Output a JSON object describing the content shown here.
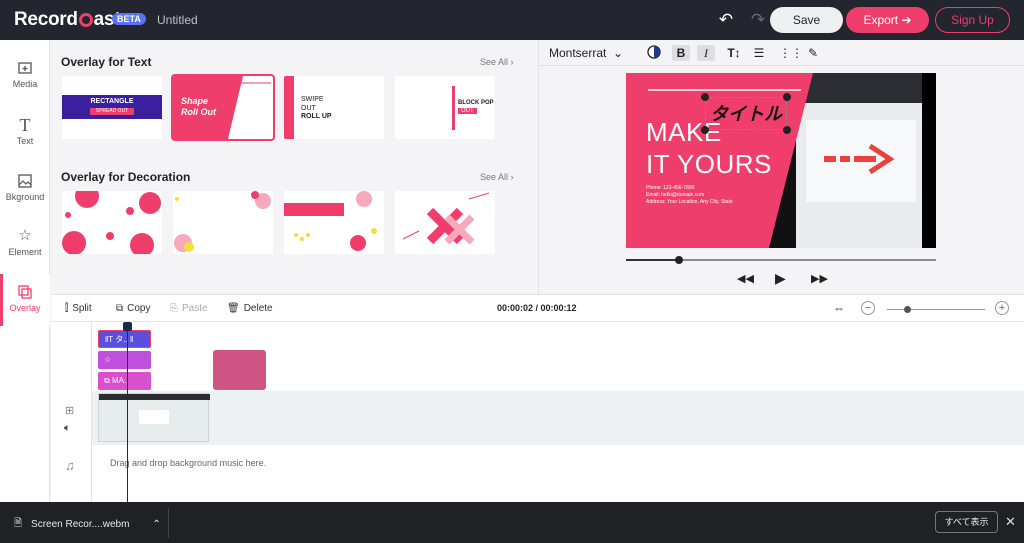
{
  "app": {
    "logo_left": "Record",
    "logo_right": "ast",
    "beta": "BETA",
    "doc_title": "Untitled"
  },
  "header": {
    "save": "Save",
    "export": "Export",
    "signup": "Sign Up",
    "undo_icon": "undo-icon",
    "redo_icon": "redo-icon"
  },
  "nav": [
    {
      "label": "Media",
      "icon": "media-icon"
    },
    {
      "label": "Text",
      "icon": "text-icon"
    },
    {
      "label": "Bkground",
      "icon": "background-icon"
    },
    {
      "label": "Element",
      "icon": "star-icon"
    },
    {
      "label": "Overlay",
      "icon": "overlay-icon",
      "active": true
    }
  ],
  "gallery": {
    "text_section": "Overlay for Text",
    "deco_section": "Overlay for Decoration",
    "see_all": "See All",
    "text_tiles": {
      "t1a": "RECTANGLE",
      "t1b": "SPREAD OUT",
      "t2a": "Shape",
      "t2b": "Roll Out",
      "t3a": "SWIPE",
      "t3b": "OUT",
      "t3c": "ROLL UP",
      "t4a": "BLOCK POP",
      "t4b": "OUT"
    }
  },
  "preview": {
    "font": "Montserrat",
    "headline1": "MAKE",
    "headline2": "IT YOURS",
    "jp_title": "タイトル",
    "phone": "Phone: 123-456-7890",
    "email": "Email: hello@domain.com",
    "address": "Address: Your Location, Any City, State",
    "progress": 0.17
  },
  "timeline": {
    "split": "Split",
    "copy": "Copy",
    "paste": "Paste",
    "delete": "Delete",
    "time": "00:00:02 / 00:00:12",
    "clip_text": "タ..",
    "clip_overlay": "MA..",
    "music_hint": "Drag and drop background music here.",
    "zoom": 0.2
  },
  "download": {
    "file": "Screen Recor....webm",
    "show_all": "すべて表示"
  },
  "colors": {
    "accent": "#ef3e6b",
    "header": "#23252f",
    "clip_text": "#5b4fe0",
    "clip_element": "#c04fdd",
    "clip_overlay": "#d84fd0"
  }
}
